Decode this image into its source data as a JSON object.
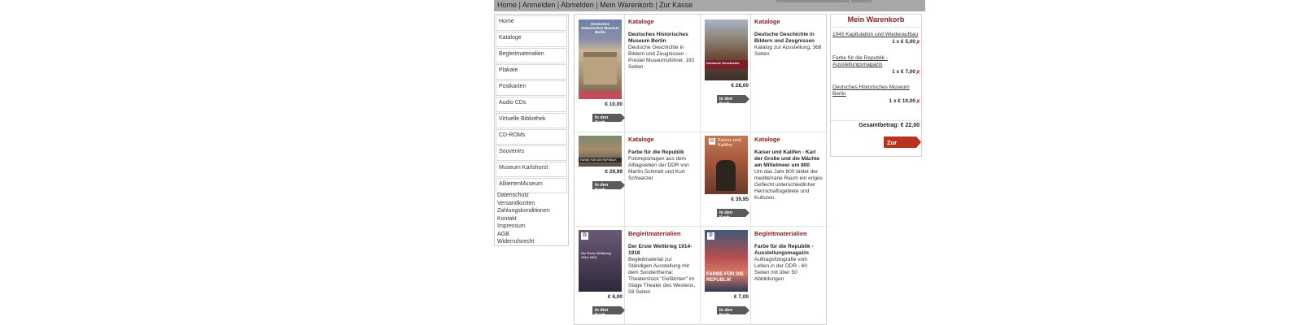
{
  "topnav": {
    "items": [
      "Home",
      "Anmelden",
      "Abmelden",
      "Mein Warenkorb",
      "Zur Kasse"
    ],
    "separator": " | "
  },
  "leftnav": {
    "items": [
      "Home",
      "Kataloge",
      "Begleitmaterialien",
      "Plakate",
      "Postkarten",
      "Audio CDs",
      "Virtuelle Bibliothek",
      "CD-ROMs",
      "Souvenirs",
      "Museum Karlshorst",
      "AlliiertenMuseum"
    ],
    "meta": [
      "Datenschutz",
      "Versandkosten",
      "Zahlungskonditionen",
      "Kontakt",
      "Impressum",
      "AGB",
      "Widerrufsrecht"
    ]
  },
  "products": [
    {
      "category": "Kataloge",
      "title": "Deutsches Historisches Museum Berlin",
      "description": "Deutsche Geschichte in Bildern und Zeugnissen - Prestel Museumsführer, 192 Seiten",
      "price": "€ 10,00",
      "button": "In den Korb",
      "cover_text": "Deutsches Historisches Museum Berlin"
    },
    {
      "category": "Kataloge",
      "title": "Deutsche Geschichte in Bildern und Zeugnissen",
      "description": "Katalog zur Ausstellung, 368 Seiten",
      "price": "€ 28,00",
      "button": "In den Korb",
      "cover_text": "Deutsche Geschichte"
    },
    {
      "category": "Kataloge",
      "title": "Farbe für die Republik",
      "description": "Fotoreportagen aus dem Alltagsleben der DDR von Martin Schmidt und Kurt Schwarzer",
      "price": "€ 29,99",
      "button": "In den Korb",
      "cover_text": "FARBE FÜR DIE REPUBLIK"
    },
    {
      "category": "Kataloge",
      "title": "Kaiser und Kalifen - Karl der Große und die Mächte am Mittelmeer um 800",
      "description": "Um das Jahr 800 bildet der mediterrane Raum ein enges Geflecht unterschiedlicher Herrschaftsgebiete und Kulturen.",
      "price": "€ 39,95",
      "button": "In den Korb",
      "cover_text": "Kaiser und Kalifen"
    },
    {
      "category": "Begleitmaterialien",
      "title": "Der Erste Weltkrieg 1914-1918",
      "description": "Begleitmaterial zur Ständigen Ausstellung mit dem Sonderthema: Theaterstück \"Gefährten\" im Stage Theater des Westens, 59 Seiten",
      "price": "€ 6,00",
      "button": "In den Korb",
      "cover_text": "Der Erste Weltkrieg 1914-1918"
    },
    {
      "category": "Begleitmaterialien",
      "title": "Farbe für die Republik - Ausstellungsmagazin",
      "description": "Auftragsfotografie vom Leben in der DDR - 60 Seiten mit über 50 Abbildungen",
      "price": "€ 7,00",
      "button": "In den Korb",
      "cover_text": "FARBE FÜR DIE REPUBLIK"
    }
  ],
  "cart": {
    "title": "Mein Warenkorb",
    "items": [
      {
        "name": "1945 Kapitulation und Wiederaufbau",
        "qty": "1 x € 5,00"
      },
      {
        "name": "Farbe für die Republik - Ausstellungsmagazin",
        "qty": "1 x € 7,00"
      },
      {
        "name": "Deutsches Historisches Museum Berlin",
        "qty": "1 x € 10,00"
      }
    ],
    "remove_symbol": "✗",
    "total": "Gesamtbetrag: € 22,00",
    "checkout": "Zur Kasse"
  },
  "colors": {
    "accent": "#8a1d1d",
    "checkout": "#b6331e",
    "topbar": "#a7a7a7",
    "button": "#5b5b5b"
  }
}
